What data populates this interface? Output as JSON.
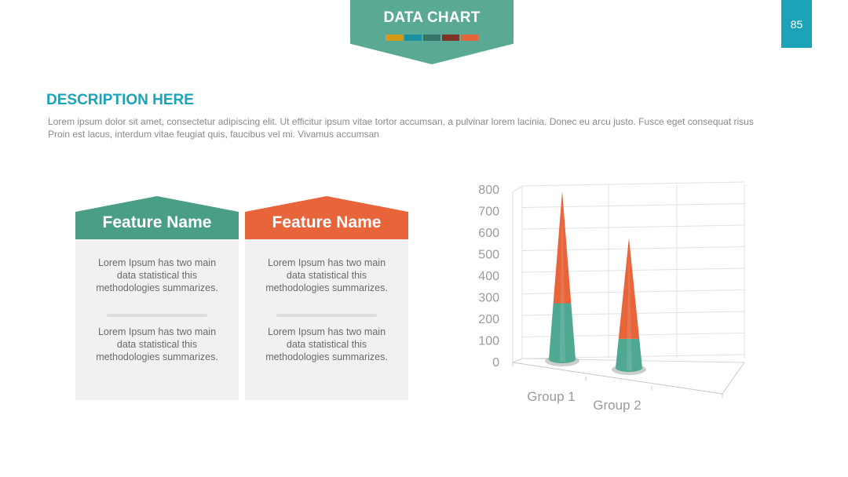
{
  "header": {
    "title": "DATA CHART",
    "swatch_colors": [
      "#d49a1c",
      "#1d8fa3",
      "#357568",
      "#7d3427",
      "#e5643a"
    ],
    "page_number": "85"
  },
  "description": {
    "title": "DESCRIPTION HERE",
    "body": "Lorem ipsum dolor sit amet, consectetur adipiscing elit. Ut efficitur ipsum vitae tortor accumsan, a pulvinar lorem lacinia. Donec eu arcu justo. Fusce eget consequat risus Proin est lacus, interdum vitae feugiat quis, faucibus vel mi.  Vivamus accumsan"
  },
  "features": [
    {
      "title": "Feature Name",
      "color": "#4a9e86",
      "text_1": "Lorem Ipsum has two main data statistical this methodologies summarizes.",
      "text_2": "Lorem Ipsum has two main data statistical this methodologies summarizes."
    },
    {
      "title": "Feature Name",
      "color": "#e8643a",
      "text_1": "Lorem Ipsum has two main data statistical this methodologies summarizes.",
      "text_2": "Lorem Ipsum has two main data statistical this methodologies summarizes."
    }
  ],
  "chart_data": {
    "type": "bar",
    "style": "3d stacked cone",
    "categories": [
      "Group 1",
      "Group 2"
    ],
    "series": [
      {
        "values": [
          250,
          130
        ],
        "color": "#4fa891"
      },
      {
        "values": [
          500,
          450
        ],
        "color": "#e8643a"
      }
    ],
    "ylim": [
      0,
      800
    ],
    "yticks": [
      "0",
      "100",
      "200",
      "300",
      "400",
      "500",
      "600",
      "700",
      "800"
    ],
    "grid": true,
    "legend": "none"
  }
}
